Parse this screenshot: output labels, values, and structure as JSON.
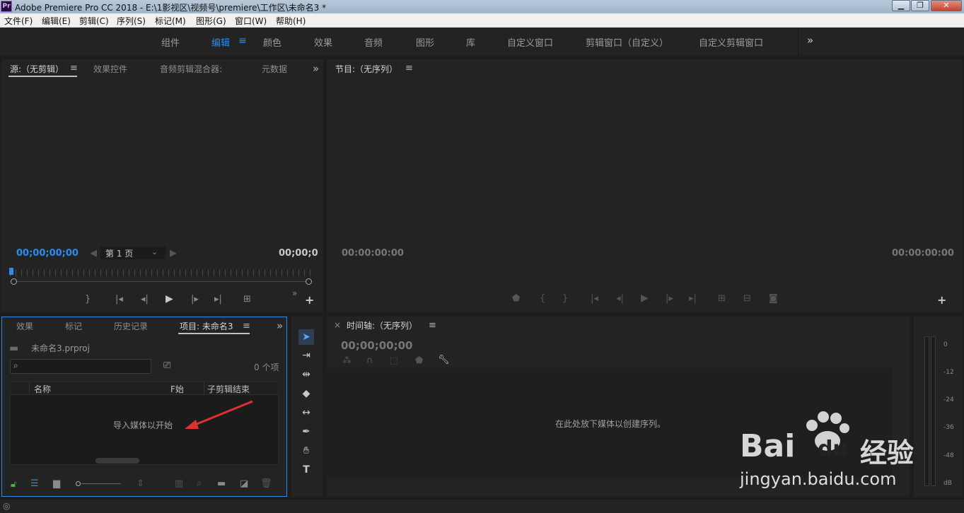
{
  "window": {
    "app_icon_text": "Pr",
    "title": "Adobe Premiere Pro CC 2018 - E:\\1影视区\\视频号\\premiere\\工作区\\未命名3 *",
    "buttons": {
      "minimize": "▁",
      "maximize": "❐",
      "close": "✕"
    }
  },
  "menu": [
    "文件(F)",
    "编辑(E)",
    "剪辑(C)",
    "序列(S)",
    "标记(M)",
    "图形(G)",
    "窗口(W)",
    "帮助(H)"
  ],
  "workspaces": {
    "items": [
      "组件",
      "编辑",
      "颜色",
      "效果",
      "音频",
      "图形",
      "库",
      "自定义窗口",
      "剪辑窗口（自定义）",
      "自定义剪辑窗口"
    ],
    "active": "编辑",
    "menu_glyph": "≡",
    "more_glyph": "»"
  },
  "source_panel": {
    "tabs": [
      "源:（无剪辑）",
      "效果控件",
      "音频剪辑混合器:",
      "元数据"
    ],
    "active_tab": "源:（无剪辑）",
    "timecode_in": "00;00;00;00",
    "timecode_out": "00;00;0",
    "page_select": "第 1 页",
    "more_glyph": "»",
    "add_glyph": "+"
  },
  "program_panel": {
    "tab": "节目:（无序列）",
    "timecode_in": "00:00:00:00",
    "timecode_out": "00:00:00:00",
    "add_glyph": "+"
  },
  "project_panel": {
    "tabs": [
      "效果",
      "标记",
      "历史记录",
      "项目: 未命名3"
    ],
    "active_tab": "项目: 未命名3",
    "project_file": "未命名3.prproj",
    "item_count": "0 个项",
    "columns": [
      "名称",
      "F始",
      "子剪辑结束"
    ],
    "empty_hint": "导入媒体以开始",
    "more_glyph": "»"
  },
  "timeline_panel": {
    "close_glyph": "×",
    "tab": "时间轴:（无序列）",
    "timecode": "00;00;00;00",
    "drop_hint": "在此处放下媒体以创建序列。"
  },
  "audio_meter": {
    "scale": [
      "0",
      "-12",
      "-24",
      "-36",
      "-48",
      "dB"
    ]
  },
  "watermark": {
    "logo": "Bai",
    "logo2": "du",
    "logo_cn": "经验",
    "url": "jingyan.baidu.com"
  },
  "colors": {
    "accent": "#2d8ceb",
    "panel_bg": "#232323",
    "project_focus_border": "#2d8ceb",
    "arrow": "#e03030"
  }
}
